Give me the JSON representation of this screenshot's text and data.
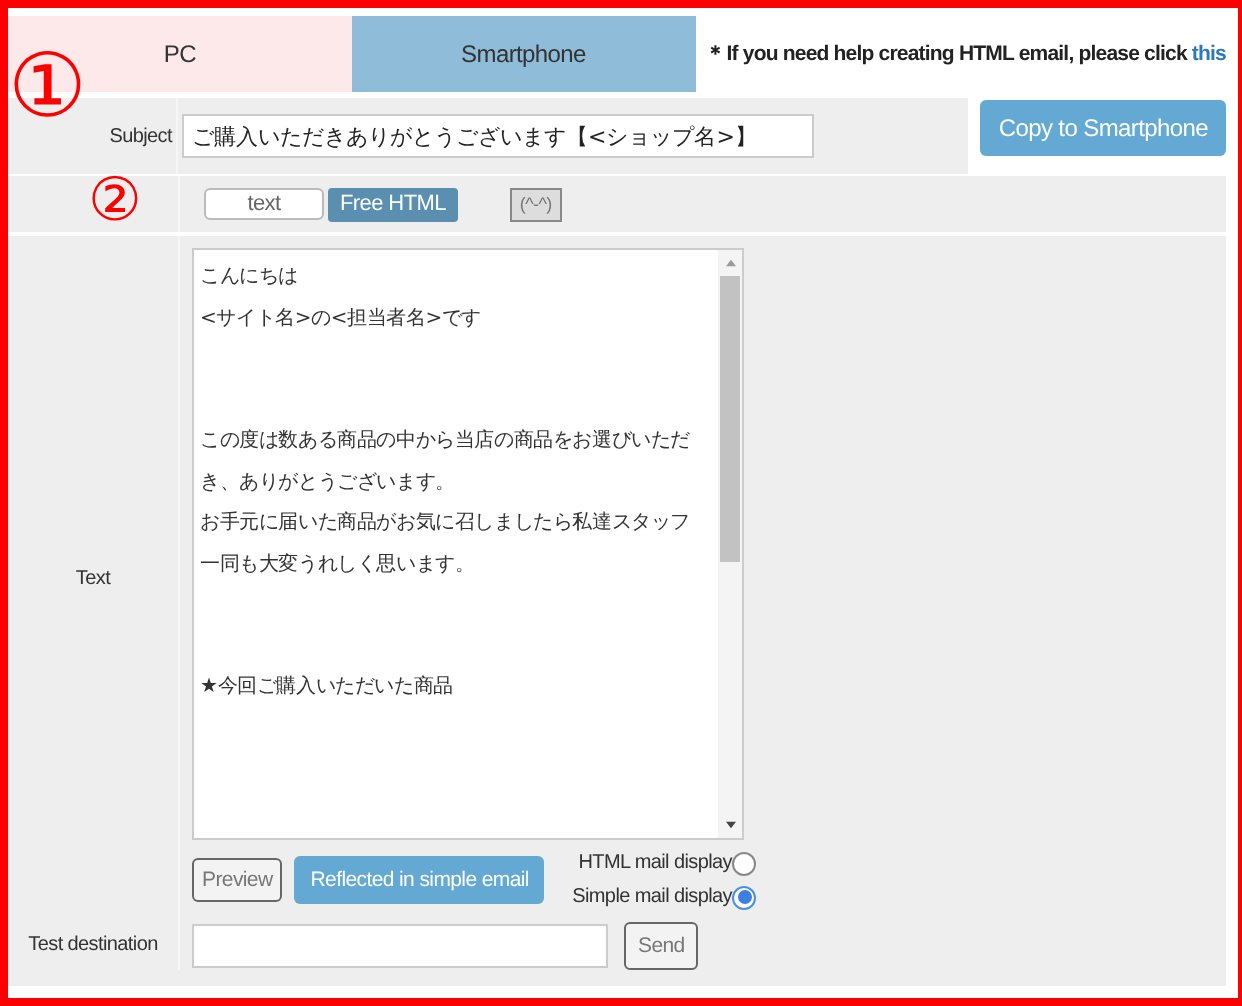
{
  "tabs": [
    {
      "label": "PC",
      "selected": true
    },
    {
      "label": "Smartphone",
      "selected": false
    }
  ],
  "help_note": {
    "text": "＊If you need help creating HTML email, please click ",
    "link": "this"
  },
  "subject": {
    "label": "Subject",
    "value": "ご購入いただきありがとうございます【<ショップ名>】",
    "copy_button": "Copy to Smartphone"
  },
  "toolbar": [
    {
      "kind": "outline",
      "label": "text"
    },
    {
      "kind": "dark",
      "label": "Free HTML"
    },
    {
      "kind": "grey",
      "label": "(^-^)"
    }
  ],
  "text": {
    "label": "Text",
    "paragraphs": [
      [
        "こんにちは",
        "<サイト名>の<担当者名>です"
      ],
      [
        "この度は数ある商品の中から当店の商品をお選びいただ",
        "き、ありがとうございます。",
        "お手元に届いた商品がお気に召しましたら私達スタッフ",
        "一同も大変うれしく思います。"
      ],
      [
        "★今回ご購入いただいた商品"
      ]
    ]
  },
  "actions": [
    {
      "kind": "outline",
      "label": "Preview"
    },
    {
      "kind": "blue",
      "label": "Reflected in simple email"
    }
  ],
  "display_options": [
    {
      "label": "HTML mail display",
      "selected": false
    },
    {
      "label": "Simple mail display",
      "selected": true
    }
  ],
  "test_destination": {
    "label": "Test destination",
    "button": "Send"
  },
  "annotations": [
    "①",
    "②"
  ]
}
